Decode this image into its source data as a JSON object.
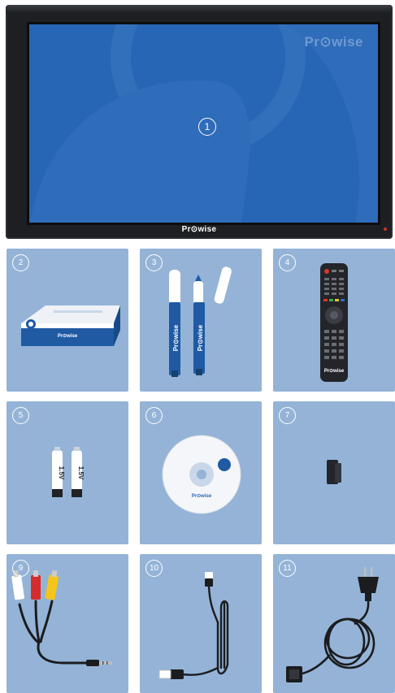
{
  "display": {
    "number": "1",
    "screen_logo": "Pr⊙wise",
    "bezel_logo": "Pr⊙wise"
  },
  "items": [
    {
      "number": "2",
      "name": "box-icon",
      "label": "Pr⊙wise"
    },
    {
      "number": "3",
      "name": "pens-icon",
      "label": "Pr⊙wise"
    },
    {
      "number": "4",
      "name": "remote-control-icon",
      "label": "Pr⊙wise"
    },
    {
      "number": "5",
      "name": "batteries-icon",
      "label": "1.5V"
    },
    {
      "number": "6",
      "name": "cd-icon",
      "label": "Pr⊙wise"
    },
    {
      "number": "7",
      "name": "clip-icon",
      "label": ""
    },
    {
      "number": "9",
      "name": "av-cable-icon",
      "label": ""
    },
    {
      "number": "10",
      "name": "usb-cable-icon",
      "label": ""
    },
    {
      "number": "11",
      "name": "power-cable-icon",
      "label": ""
    }
  ],
  "colors": {
    "tile_bg": "#94b3d7",
    "screen_bg": "#2766b4",
    "brand_blue": "#1f5aa3",
    "bezel": "#1d1f22"
  }
}
